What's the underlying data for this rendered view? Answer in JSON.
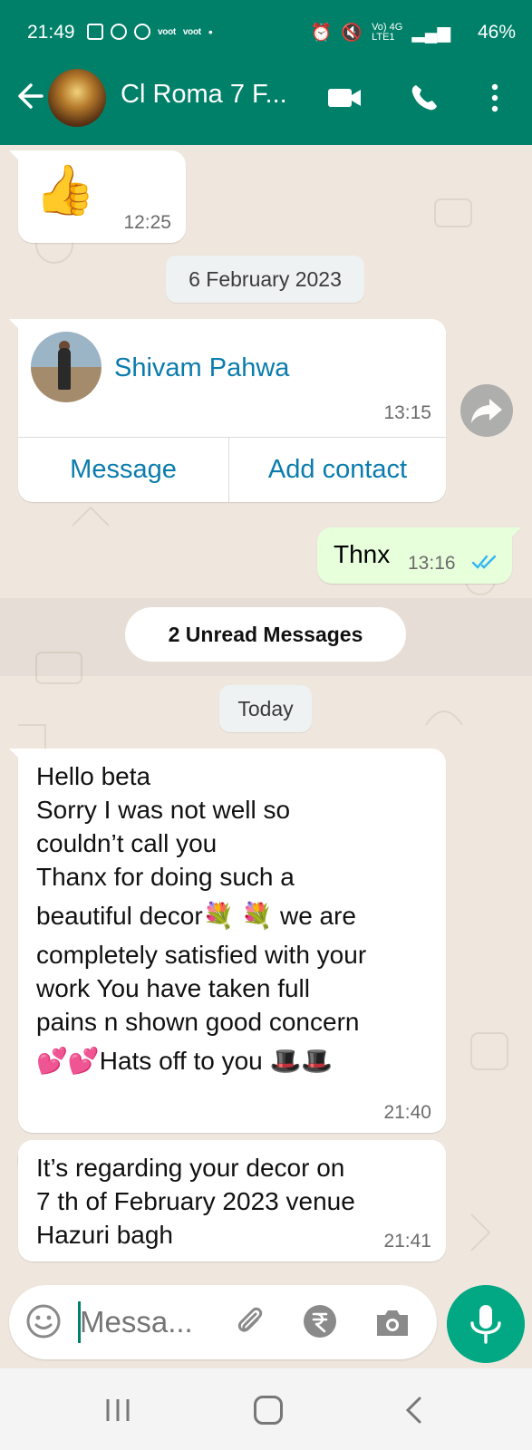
{
  "status_bar": {
    "time": "21:49",
    "voot_label": "voot",
    "network": "Vo) 4G",
    "lte": "LTE1",
    "battery": "46%"
  },
  "header": {
    "title": "Cl Roma 7 F...",
    "colors": {
      "bar": "#008069"
    }
  },
  "messages": [
    {
      "type": "emoji",
      "content": "👍",
      "time": "12:25"
    },
    {
      "type": "date",
      "label": "6 February 2023"
    },
    {
      "type": "contact",
      "name": "Shivam Pahwa",
      "time": "13:15",
      "actions": [
        "Message",
        "Add contact"
      ]
    },
    {
      "type": "outgoing",
      "text": "Thnx",
      "time": "13:16",
      "status": "read"
    },
    {
      "type": "unread",
      "label": "2 Unread Messages"
    },
    {
      "type": "date",
      "label": "Today"
    },
    {
      "type": "incoming",
      "lines": [
        "Hello beta",
        "Sorry I was not well so",
        "couldn’t call you",
        "Thanx for doing such a",
        "beautiful decor💐 💐  we are",
        "completely satisfied with your",
        "work   You have taken full",
        "pains n shown good concern",
        "💕💕Hats off to you 🎩🎩"
      ],
      "time": "21:40"
    },
    {
      "type": "incoming",
      "lines": [
        "It’s regarding your decor on",
        "7 th of February 2023 venue",
        "Hazuri bagh"
      ],
      "time": "21:41"
    }
  ],
  "composer": {
    "placeholder": "Messa..."
  },
  "colors": {
    "incoming_bubble": "#ffffff",
    "outgoing_bubble": "#e7ffdb",
    "link_blue": "#0a7cad",
    "mic_green": "#02a884",
    "chat_bg": "#efe7de"
  }
}
